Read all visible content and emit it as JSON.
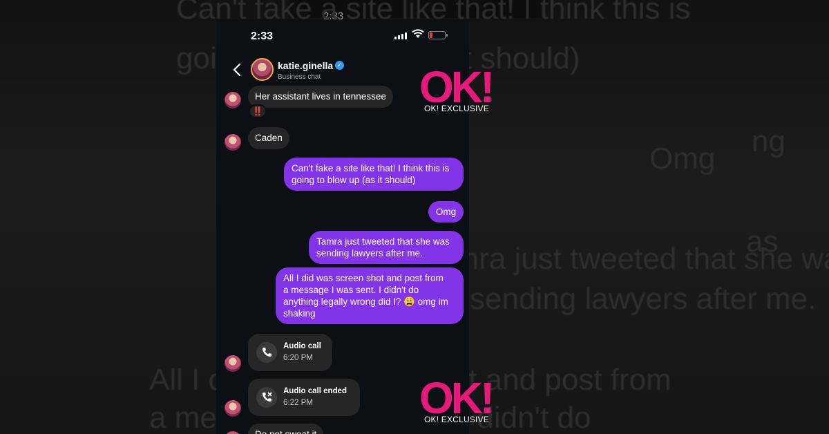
{
  "background": {
    "phone_time": "2:33",
    "lines": [
      "Can't fake a site like that! I think this is",
      "going to blow up (as it should)",
      "Omg",
      "ng",
      "as",
      "Tamra just tweeted that she was",
      "sending lawyers after me.",
      "All I did was screen shot and post from",
      "a message I was sent. I didn't do"
    ]
  },
  "status_bar": {
    "time": "2:33"
  },
  "header": {
    "username": "katie.ginella",
    "verified_symbol": "✓",
    "subtitle": "Business chat"
  },
  "messages": {
    "m1": {
      "text": "Her assistant lives in tennessee",
      "reaction": "‼️"
    },
    "m2": {
      "text": "Caden"
    },
    "m3": {
      "text_line1": "Can't fake a site like that! I think this is",
      "text_line2": "going to blow up (as it should)"
    },
    "m4": {
      "text": "Omg"
    },
    "m5": {
      "text_line1": "Tamra just tweeted that she was",
      "text_line2": "sending lawyers after me."
    },
    "m6": {
      "text_line1": "All I did was screen shot and post from",
      "text_line2": "a message I was sent. I didn't do",
      "text_line3": "anything legally wrong did I? 😩 omg im",
      "text_line4": "shaking"
    },
    "call1": {
      "title": "Audio call",
      "time": "6:20 PM",
      "icon": "phone-icon"
    },
    "call2": {
      "title": "Audio call ended",
      "time": "6:22 PM",
      "icon": "phone-ended-icon"
    },
    "m7": {
      "text": "Do not sweat it"
    }
  },
  "watermark": {
    "logo": "OK!",
    "label": "OK! EXCLUSIVE"
  },
  "colors": {
    "outgoing": "#8434e8",
    "incoming": "#262626",
    "brand": "#e8197d",
    "verified": "#3897f0"
  }
}
